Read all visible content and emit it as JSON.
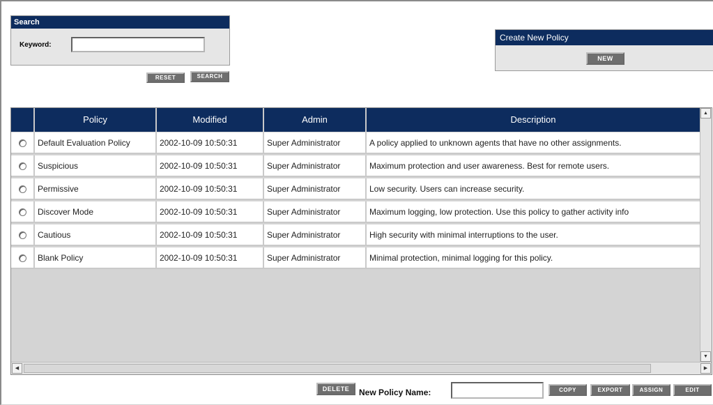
{
  "search": {
    "header": "Search",
    "keyword_label": "Keyword:",
    "keyword_value": "",
    "reset_label": "RESET",
    "search_label": "SEARCH"
  },
  "create": {
    "header": "Create New Policy",
    "new_label": "NEW"
  },
  "table": {
    "columns": [
      "",
      "Policy",
      "Modified",
      "Admin",
      "Description"
    ],
    "rows": [
      {
        "policy": "Default Evaluation Policy",
        "modified": "2002-10-09 10:50:31",
        "admin": "Super Administrator",
        "description": "A policy applied to unknown agents that have no other assignments."
      },
      {
        "policy": "Suspicious",
        "modified": "2002-10-09 10:50:31",
        "admin": "Super Administrator",
        "description": "Maximum protection and user awareness. Best for remote users."
      },
      {
        "policy": "Permissive",
        "modified": "2002-10-09 10:50:31",
        "admin": "Super Administrator",
        "description": "Low security. Users can increase security."
      },
      {
        "policy": "Discover Mode",
        "modified": "2002-10-09 10:50:31",
        "admin": "Super Administrator",
        "description": "Maximum logging, low protection. Use this policy to gather activity info"
      },
      {
        "policy": "Cautious",
        "modified": "2002-10-09 10:50:31",
        "admin": "Super Administrator",
        "description": "High security with minimal interruptions to the user."
      },
      {
        "policy": "Blank Policy",
        "modified": "2002-10-09 10:50:31",
        "admin": "Super Administrator",
        "description": "Minimal protection, minimal logging for this policy."
      }
    ]
  },
  "footer": {
    "delete_label": "DELETE",
    "new_policy_name_label": "New Policy Name:",
    "new_policy_name_value": "",
    "copy_label": "COPY",
    "export_label": "EXPORT",
    "assign_label": "ASSIGN",
    "edit_label": "EDIT"
  },
  "colors": {
    "header_bg": "#0d2c5e",
    "panel_bg": "#e6e6e6",
    "button_bg": "#6e6e6e"
  }
}
